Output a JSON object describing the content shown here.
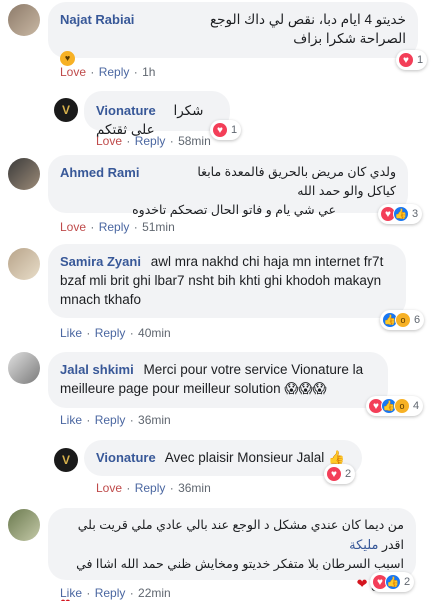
{
  "comments": [
    {
      "author": "Najat Rabiai",
      "text": "خديتو 4 ايام دبا، نقص لي داك الوجع الصراحة شكرا بزاف",
      "emoji": "😍",
      "actions": [
        "Love",
        "Reply"
      ],
      "time": "1h",
      "reaction_count": "1"
    },
    {
      "author": "Vionature",
      "text": "شكرا على ثقتكم",
      "actions": [
        "Love",
        "Reply"
      ],
      "time": "58min",
      "reaction_count": "1"
    },
    {
      "author": "Ahmed Rami",
      "text_line1": "ولدي كان مريض بالحريق فالمعدة مابغا كياكل والو حمد الله",
      "text_line2": "عي شي يام و فاتو الحال تصحكم تاخدوه",
      "actions": [
        "Love",
        "Reply"
      ],
      "time": "51min",
      "reaction_count": "3"
    },
    {
      "author": "Samira Zyani",
      "text": "awl mra nakhd chi haja mn internet fr7t bzaf mli brit ghi lbar7 nsht bih khti ghi khodoh makayn mnach tkhafo",
      "actions": [
        "Like",
        "Reply"
      ],
      "time": "40min",
      "reaction_count": "6"
    },
    {
      "author": "Jalal shkimi",
      "text": "Merci pour votre service Vionature la meilleure page pour meilleur solution",
      "emoji": "😱😱😱",
      "actions": [
        "Like",
        "Reply"
      ],
      "time": "36min",
      "reaction_count": "4"
    },
    {
      "author": "Vionature",
      "text": "Avec plaisir Monsieur Jalal",
      "emoji": "👍",
      "actions": [
        "Love",
        "Reply"
      ],
      "time": "36min",
      "reaction_count": "2"
    },
    {
      "author": "مليكة",
      "text_line1": "من ديما كان عندي مشكل د الوجع عند بالي عادي ملي قريت بلي اقدر",
      "text_line2": "اسبب السرطان بلا متفكر خديتو ومخايش ظني حمد الله اشاا في الجميع",
      "actions": [
        "Like",
        "Reply"
      ],
      "time": "22min",
      "reaction_count": "2"
    }
  ]
}
